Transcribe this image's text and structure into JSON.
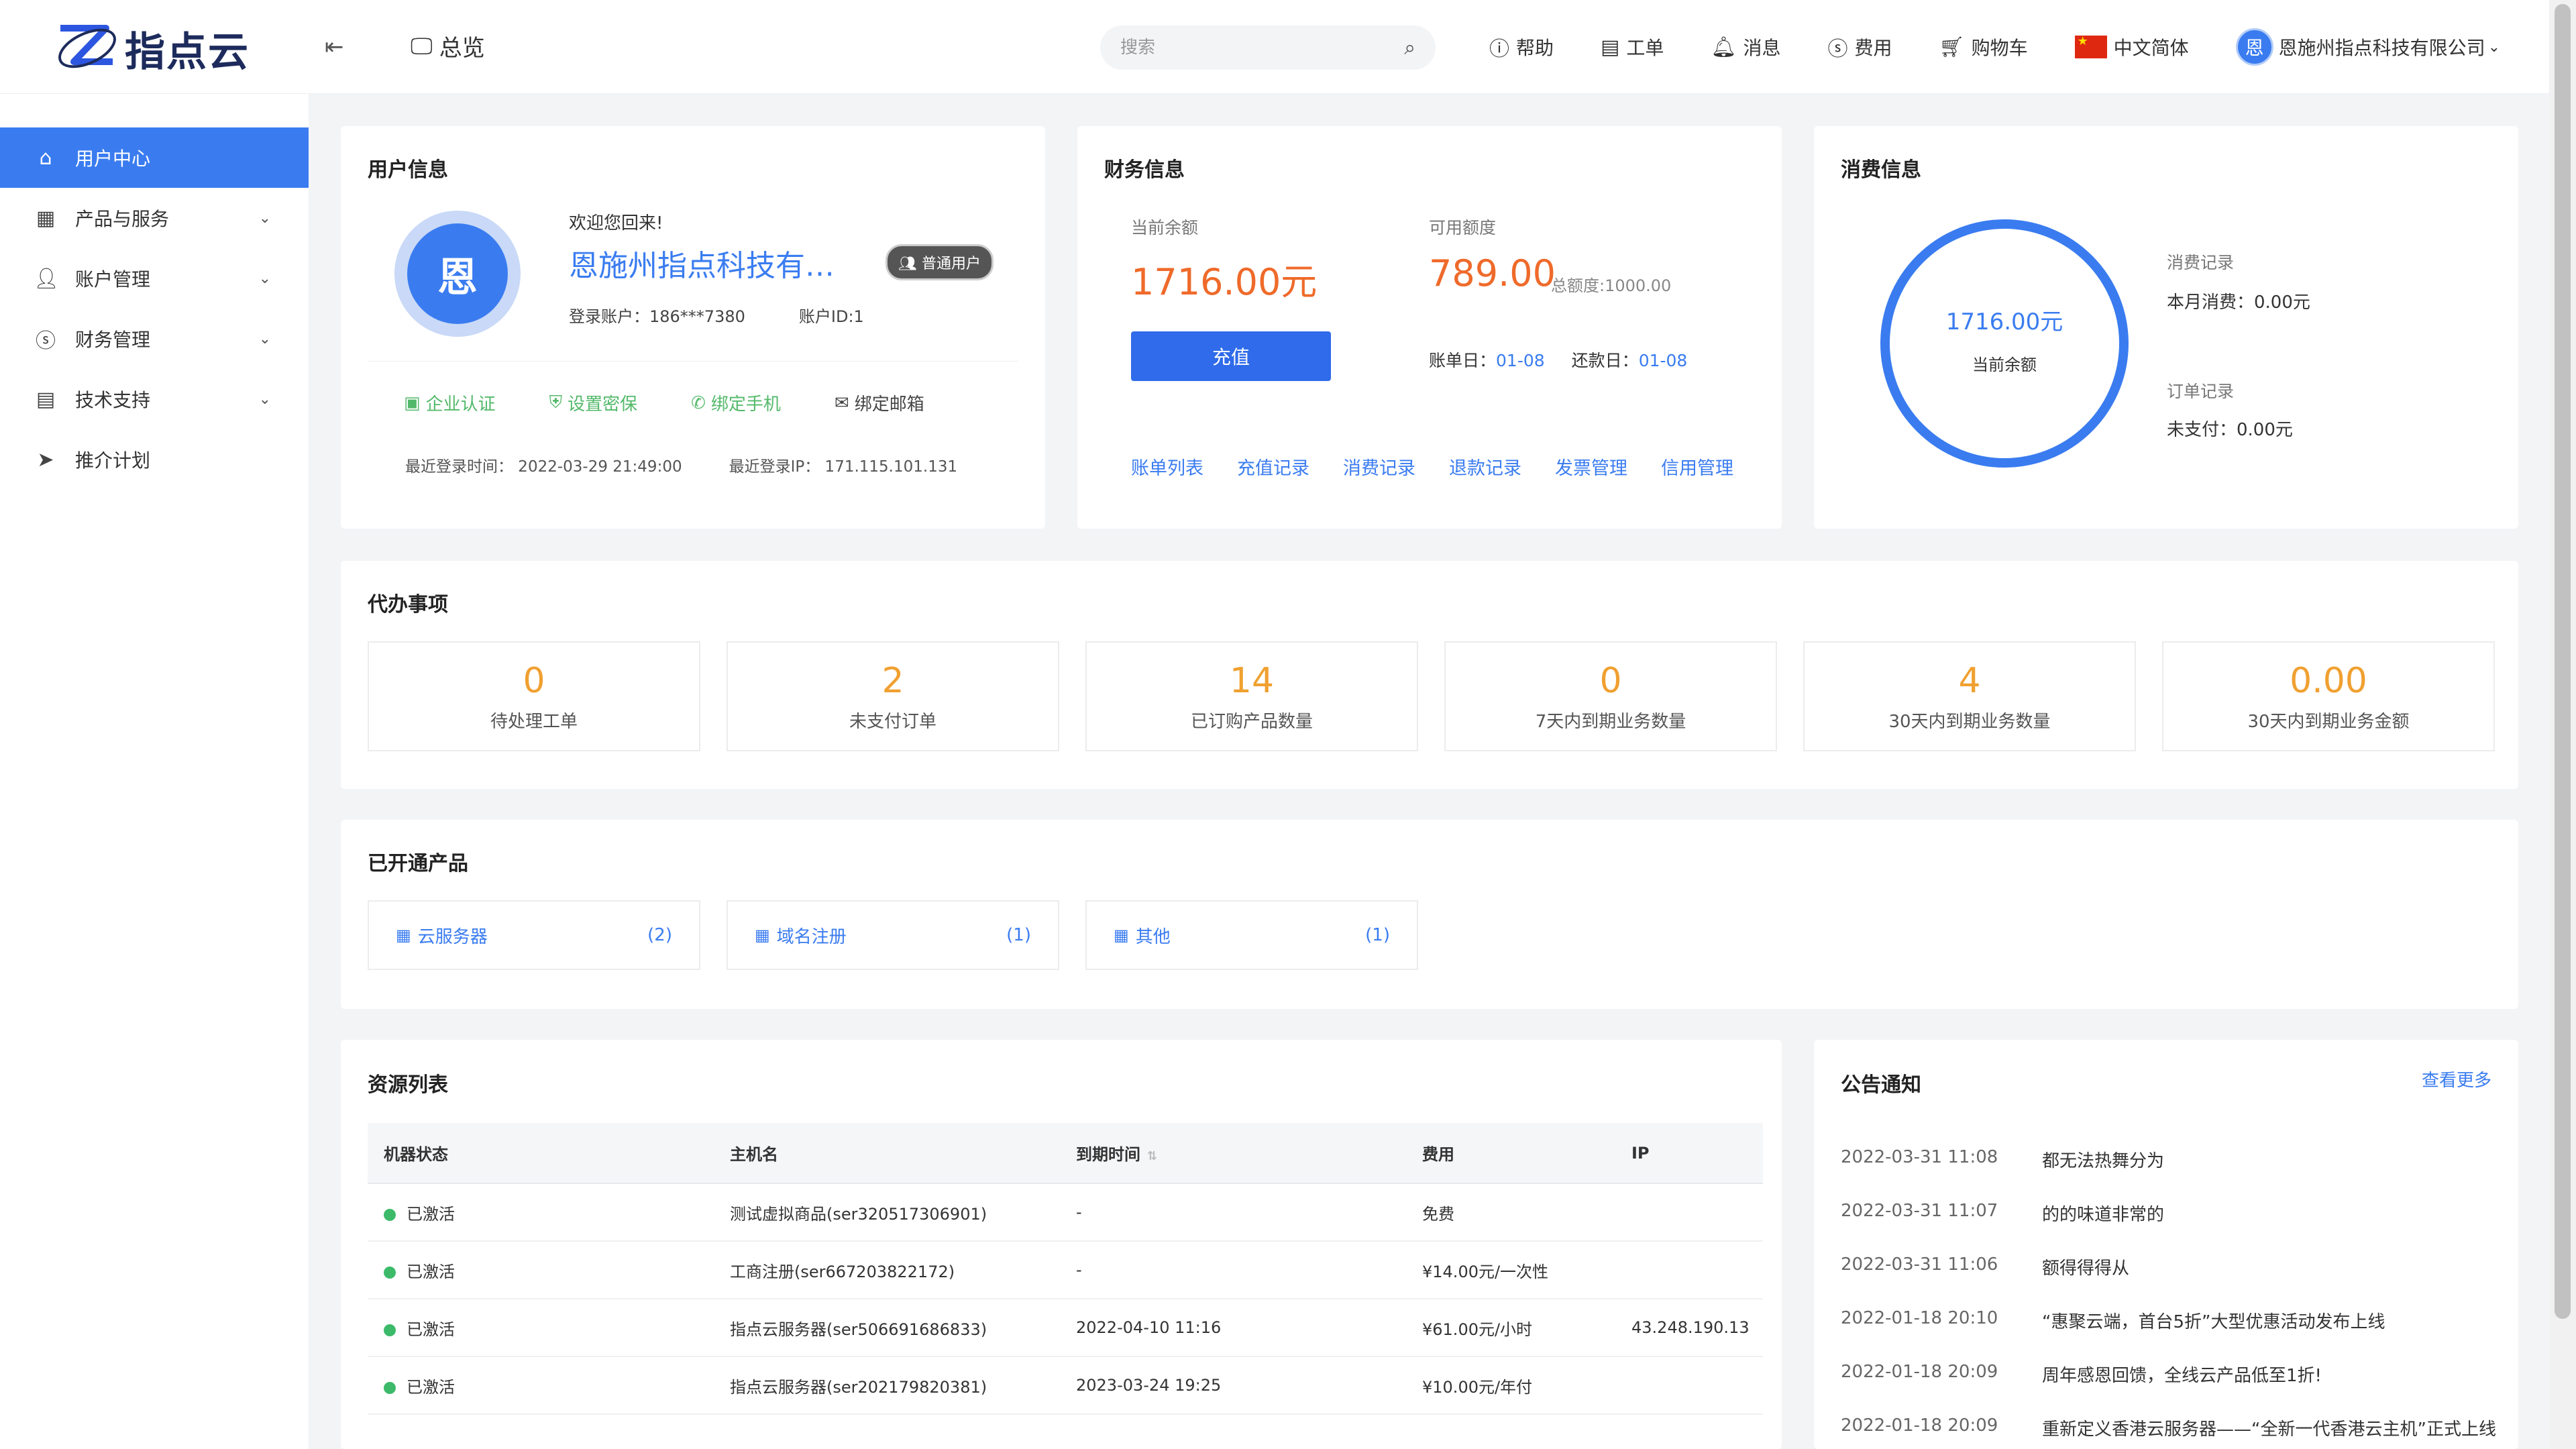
{
  "brand": {
    "name": "指点云"
  },
  "topbar": {
    "overview": "总览",
    "search_placeholder": "搜索",
    "nav": [
      {
        "label": "帮助",
        "icon": "help-icon"
      },
      {
        "label": "工单",
        "icon": "ticket-icon"
      },
      {
        "label": "消息",
        "icon": "bell-icon"
      },
      {
        "label": "费用",
        "icon": "dollar-icon"
      },
      {
        "label": "购物车",
        "icon": "cart-icon"
      }
    ],
    "language": "中文简体",
    "user_avatar": "恩",
    "user_name": "恩施州指点科技有限公司"
  },
  "sidebar": {
    "items": [
      {
        "label": "用户中心",
        "icon": "home-icon",
        "active": true
      },
      {
        "label": "产品与服务",
        "icon": "grid-icon"
      },
      {
        "label": "账户管理",
        "icon": "user-icon"
      },
      {
        "label": "财务管理",
        "icon": "dollar-icon"
      },
      {
        "label": "技术支持",
        "icon": "document-icon"
      },
      {
        "label": "推介计划",
        "icon": "send-icon"
      }
    ]
  },
  "user_info": {
    "title": "用户信息",
    "avatar_char": "恩",
    "welcome": "欢迎您回来!",
    "company": "恩施州指点科技有…",
    "badge": "普通用户",
    "account_label": "登录账户：186***7380",
    "account_id": "账户ID:1",
    "actions": [
      "企业认证",
      "设置密保",
      "绑定手机",
      "绑定邮箱"
    ],
    "last_login_time": "最近登录时间：  2022-03-29 21:49:00",
    "last_login_ip": "最近登录IP：  171.115.101.131"
  },
  "finance": {
    "title": "财务信息",
    "balance_label": "当前余额",
    "balance": "1716.00元",
    "credit_label": "可用额度",
    "credit": "789.00",
    "credit_total": "总额度:1000.00",
    "recharge": "充值",
    "bill_day_label": "账单日：",
    "bill_day": "01-08",
    "repay_day_label": "还款日：",
    "repay_day": "01-08",
    "links": [
      "账单列表",
      "充值记录",
      "消费记录",
      "退款记录",
      "发票管理",
      "信用管理"
    ]
  },
  "consumption": {
    "title": "消费信息",
    "ring_value": "1716.00元",
    "ring_label": "当前余额",
    "record_title": "消费记录",
    "month_spend": "本月消费：0.00元",
    "order_title": "订单记录",
    "unpaid": "未支付：0.00元"
  },
  "todo": {
    "title": "代办事项",
    "items": [
      {
        "value": "0",
        "label": "待处理工单"
      },
      {
        "value": "2",
        "label": "未支付订单"
      },
      {
        "value": "14",
        "label": "已订购产品数量"
      },
      {
        "value": "0",
        "label": "7天内到期业务数量"
      },
      {
        "value": "4",
        "label": "30天内到期业务数量"
      },
      {
        "value": "0.00",
        "label": "30天内到期业务金额"
      }
    ]
  },
  "products": {
    "title": "已开通产品",
    "items": [
      {
        "name": "云服务器",
        "count": "(2)"
      },
      {
        "name": "域名注册",
        "count": "(1)"
      },
      {
        "name": "其他",
        "count": "(1)"
      }
    ]
  },
  "resources": {
    "title": "资源列表",
    "columns": [
      "机器状态",
      "主机名",
      "到期时间",
      "费用",
      "IP"
    ],
    "rows": [
      {
        "status": "已激活",
        "host": "测试虚拟商品(ser320517306901)",
        "expire": "-",
        "fee": "免费",
        "ip": ""
      },
      {
        "status": "已激活",
        "host": "工商注册(ser667203822172)",
        "expire": "-",
        "fee": "¥14.00元/一次性",
        "ip": ""
      },
      {
        "status": "已激活",
        "host": "指点云服务器(ser506691686833)",
        "expire": "2022-04-10 11:16",
        "fee": "¥61.00元/小时",
        "ip": "43.248.190.13"
      },
      {
        "status": "已激活",
        "host": "指点云服务器(ser202179820381)",
        "expire": "2023-03-24 19:25",
        "fee": "¥10.00元/年付",
        "ip": ""
      }
    ]
  },
  "announcements": {
    "title": "公告通知",
    "more": "查看更多",
    "items": [
      {
        "date": "2022-03-31 11:08",
        "text": "都无法热舞分为"
      },
      {
        "date": "2022-03-31 11:07",
        "text": "的的味道非常的"
      },
      {
        "date": "2022-03-31 11:06",
        "text": "额得得得从"
      },
      {
        "date": "2022-01-18 20:10",
        "text": "“惠聚云端，首台5折”大型优惠活动发布上线"
      },
      {
        "date": "2022-01-18 20:09",
        "text": "周年感恩回馈，全线云产品低至1折!"
      },
      {
        "date": "2022-01-18 20:09",
        "text": "重新定义香港云服务器——“全新一代香港云主机”正式上线"
      }
    ]
  },
  "colors": {
    "accent": "#3a7cf0",
    "orange": "#ef6a2a",
    "todo": "#f0a030",
    "success": "#3cba6a"
  }
}
